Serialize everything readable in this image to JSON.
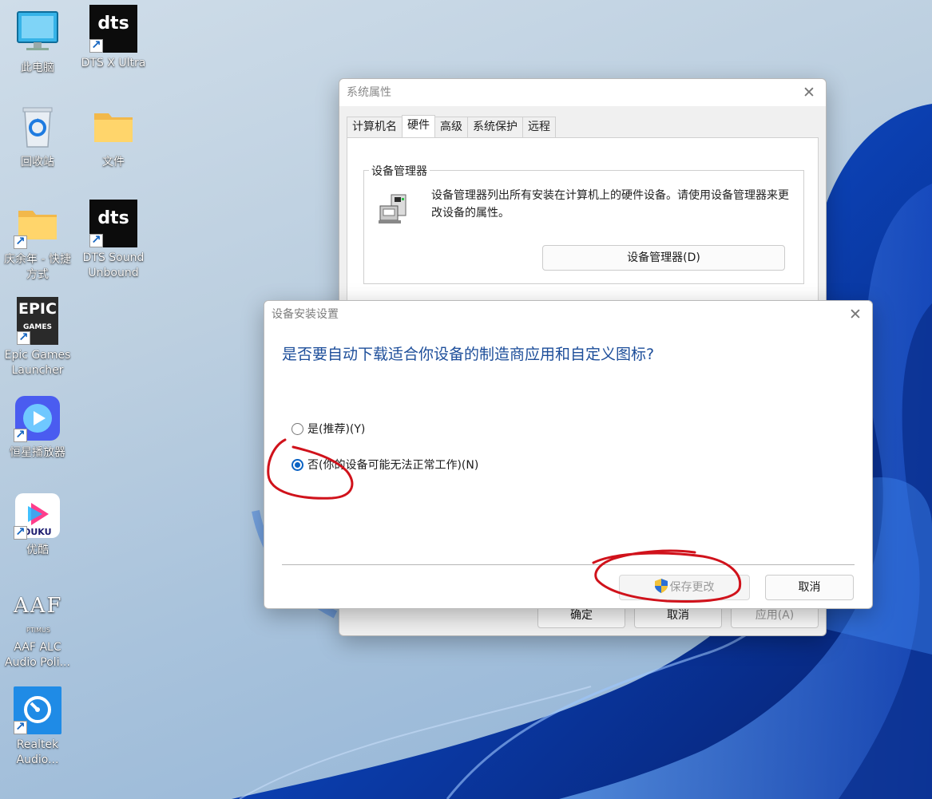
{
  "desktop": {
    "icons": [
      {
        "label": "此电脑",
        "icon": "monitor-icon"
      },
      {
        "label": "DTS X Ultra",
        "icon": "dts-icon"
      },
      {
        "label": "回收站",
        "icon": "recycle-bin-icon"
      },
      {
        "label": "文件",
        "icon": "folder-icon"
      },
      {
        "label": "庆余年 - 快捷方式",
        "icon": "folder-shortcut-icon"
      },
      {
        "label": "DTS Sound Unbound",
        "icon": "dts-icon"
      },
      {
        "label": "Epic Games Launcher",
        "icon": "epic-games-icon"
      },
      {
        "label": "恒星播放器",
        "icon": "player-icon"
      },
      {
        "label": "优酷",
        "icon": "youku-icon"
      },
      {
        "label": "AAF ALC Audio Poli...",
        "icon": "aaf-icon"
      },
      {
        "label": "Realtek Audio...",
        "icon": "realtek-icon"
      }
    ],
    "logo_text": {
      "dts": "dts",
      "epic_line1": "EPIC",
      "epic_line2": "GAMES",
      "youku": "OUKU",
      "aaf": "AAF",
      "aaf_sub": "PTIMUS"
    }
  },
  "system_properties": {
    "title": "系统属性",
    "close_glyph": "✕",
    "tabs": [
      "计算机名",
      "硬件",
      "高级",
      "系统保护",
      "远程"
    ],
    "active_tab": "硬件",
    "device_manager": {
      "group_title": "设备管理器",
      "description": "设备管理器列出所有安装在计算机上的硬件设备。请使用设备管理器来更改设备的属性。",
      "button_label": "设备管理器(D)"
    },
    "footer": {
      "ok": "确定",
      "cancel": "取消",
      "apply": "应用(A)"
    }
  },
  "install_dialog": {
    "title": "设备安装设置",
    "close_glyph": "✕",
    "question": "是否要自动下载适合你设备的制造商应用和自定义图标?",
    "options": [
      {
        "label": "是(推荐)(Y)",
        "checked": false
      },
      {
        "label": "否(你的设备可能无法正常工作)(N)",
        "checked": true
      }
    ],
    "save_label": "保存更改",
    "cancel_label": "取消"
  },
  "colors": {
    "annotation": "#d0121b",
    "question_text": "#1d4e9a",
    "radio_selected": "#0b63c4"
  }
}
